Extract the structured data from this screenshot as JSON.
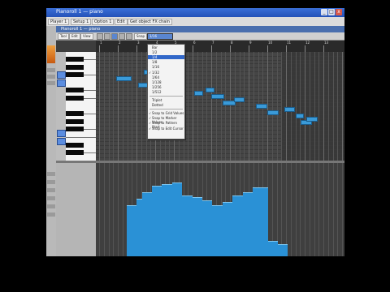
{
  "window": {
    "title": "Pianoroll 1 — piano"
  },
  "titlebar": {
    "minimize": "_",
    "maximize": "□",
    "close": "x"
  },
  "menubar": {
    "items": [
      "Player 1",
      "Setup 1",
      "Option 1",
      "Edit",
      "Get object FX chain"
    ]
  },
  "pianoroll": {
    "title": "Pianoroll 1 — piano",
    "tools": [
      "Tool",
      "Edit",
      "View"
    ],
    "snap_label": "Snap",
    "snap_value": "1/16"
  },
  "ruler": {
    "marks": [
      "1",
      "2",
      "3",
      "4",
      "5",
      "6",
      "7",
      "8",
      "9",
      "10",
      "11",
      "12",
      "13"
    ]
  },
  "snap_menu": {
    "items": [
      {
        "label": "Bar",
        "checked": false,
        "selected": false
      },
      {
        "label": "1/2",
        "checked": false,
        "selected": false
      },
      {
        "label": "1/4",
        "checked": false,
        "selected": true
      },
      {
        "label": "1/8",
        "checked": false,
        "selected": false
      },
      {
        "label": "1/16",
        "checked": false,
        "selected": false
      },
      {
        "label": "1/32",
        "checked": true,
        "selected": false
      },
      {
        "label": "1/64",
        "checked": false,
        "selected": false
      },
      {
        "label": "1/128",
        "checked": false,
        "selected": false
      },
      {
        "label": "1/256",
        "checked": false,
        "selected": false
      },
      {
        "label": "1/512",
        "checked": false,
        "selected": false
      }
    ],
    "options": [
      {
        "label": "Triplet",
        "checked": false
      },
      {
        "label": "Dotted",
        "checked": false
      }
    ],
    "toggles": [
      {
        "label": "Snap to Grid Values",
        "checked": true
      },
      {
        "label": "Snap to Marker Values",
        "checked": true
      },
      {
        "label": "Snap to Pattern Start",
        "checked": true
      },
      {
        "label": "Snap to Edit Cursor",
        "checked": true
      }
    ]
  },
  "colors": {
    "note": "#3a9ad8",
    "velocity": "#2a91d6",
    "selection": "#3167c9",
    "titlebar": "#2452b8"
  },
  "notes": [
    {
      "pitch": 0,
      "start": 16,
      "length": 8
    },
    {
      "pitch": 1,
      "start": 6,
      "length": 6
    },
    {
      "pitch": 2,
      "start": 14,
      "length": 5
    },
    {
      "pitch": 3,
      "start": 19,
      "length": 5
    },
    {
      "pitch": 4,
      "start": 22,
      "length": 4
    },
    {
      "pitch": 5,
      "start": 34,
      "length": 3
    },
    {
      "pitch": 6,
      "start": 38,
      "length": 3
    },
    {
      "pitch": 7,
      "start": 40,
      "length": 5
    },
    {
      "pitch": 8,
      "start": 44,
      "length": 5
    },
    {
      "pitch": 9,
      "start": 48,
      "length": 4
    },
    {
      "pitch": 10,
      "start": 56,
      "length": 4
    },
    {
      "pitch": 11,
      "start": 60,
      "length": 4
    },
    {
      "pitch": 12,
      "start": 66,
      "length": 4
    },
    {
      "pitch": 13,
      "start": 70,
      "length": 3
    },
    {
      "pitch": 14,
      "start": 72,
      "length": 4
    },
    {
      "pitch": 15,
      "start": 74,
      "length": 4
    }
  ],
  "velocities": [
    0.62,
    0.62,
    0.7,
    0.78,
    0.78,
    0.86,
    0.86,
    0.88,
    0.88,
    0.9,
    0.9,
    0.74,
    0.74,
    0.72,
    0.72,
    0.68,
    0.68,
    0.62,
    0.62,
    0.66,
    0.66,
    0.74,
    0.74,
    0.78,
    0.78,
    0.84,
    0.84,
    0.84,
    0.18,
    0.18,
    0.14,
    0.14
  ]
}
